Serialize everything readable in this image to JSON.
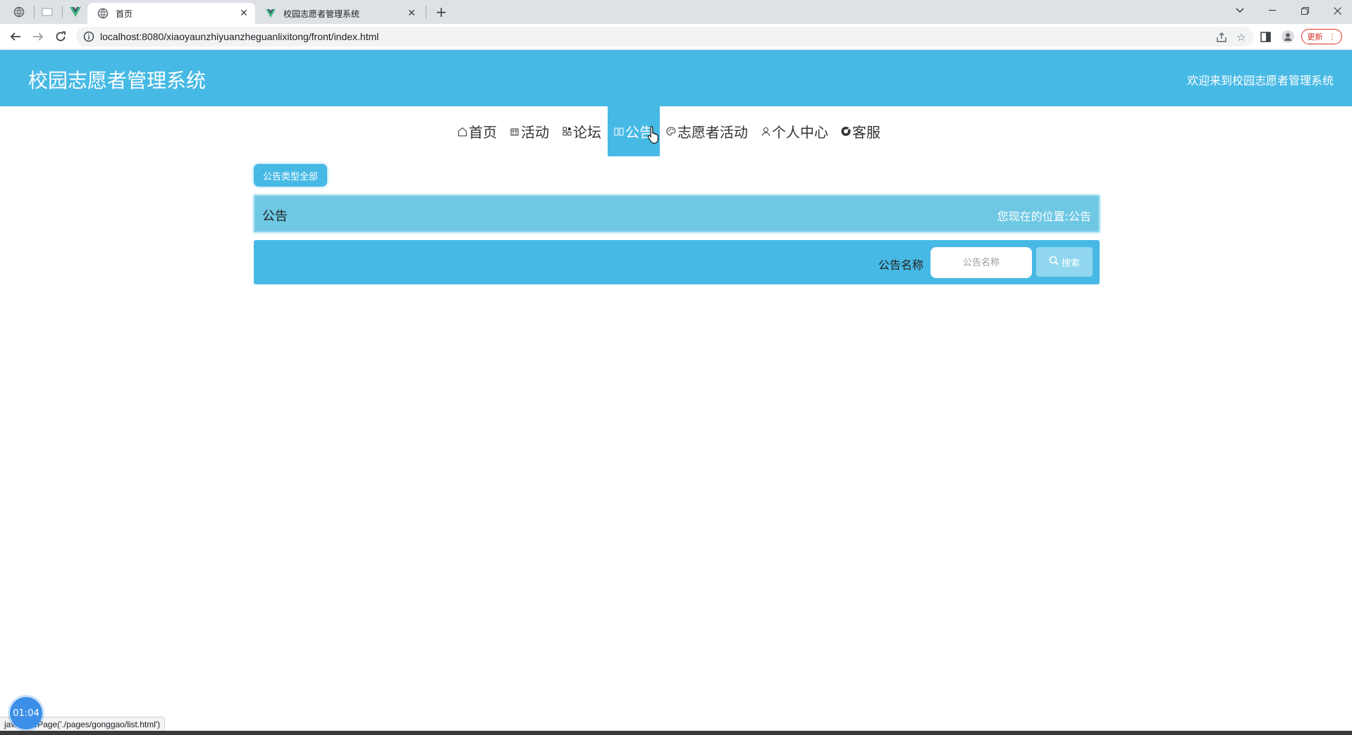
{
  "browser": {
    "tabs": [
      {
        "title": "首页",
        "active": true,
        "favicon": "globe-icon"
      },
      {
        "title": "校园志愿者管理系统",
        "active": false,
        "favicon": "vue-icon"
      }
    ],
    "url": "localhost:8080/xiaoyaunzhiyuanzheguanlixitong/front/index.html",
    "update_label": "更新"
  },
  "header": {
    "title": "校园志愿者管理系统",
    "welcome": "欢迎来到校园志愿者管理系统"
  },
  "nav": {
    "items": [
      {
        "label": "首页",
        "icon": "home-icon"
      },
      {
        "label": "活动",
        "icon": "calendar-icon"
      },
      {
        "label": "论坛",
        "icon": "grid-icon"
      },
      {
        "label": "公告",
        "icon": "notice-icon",
        "active": true
      },
      {
        "label": "志愿者活动",
        "icon": "palette-icon"
      },
      {
        "label": "个人中心",
        "icon": "user-icon"
      },
      {
        "label": "客服",
        "icon": "service-icon"
      }
    ]
  },
  "filter": {
    "type_button": "公告类型全部"
  },
  "breadcrumb": {
    "title": "公告",
    "location_prefix": "您现在的位置:",
    "location_value": "公告"
  },
  "search": {
    "label": "公告名称",
    "placeholder": "公告名称",
    "button": "搜索"
  },
  "status_bar": {
    "link_text": "jav... navPage('./pages/gonggao/list.html')"
  },
  "timer": {
    "value": "01:04"
  },
  "colors": {
    "primary": "#47b9e5",
    "breadcrumb_bg": "#6ec8e4",
    "search_button": "#8fd6ee"
  }
}
